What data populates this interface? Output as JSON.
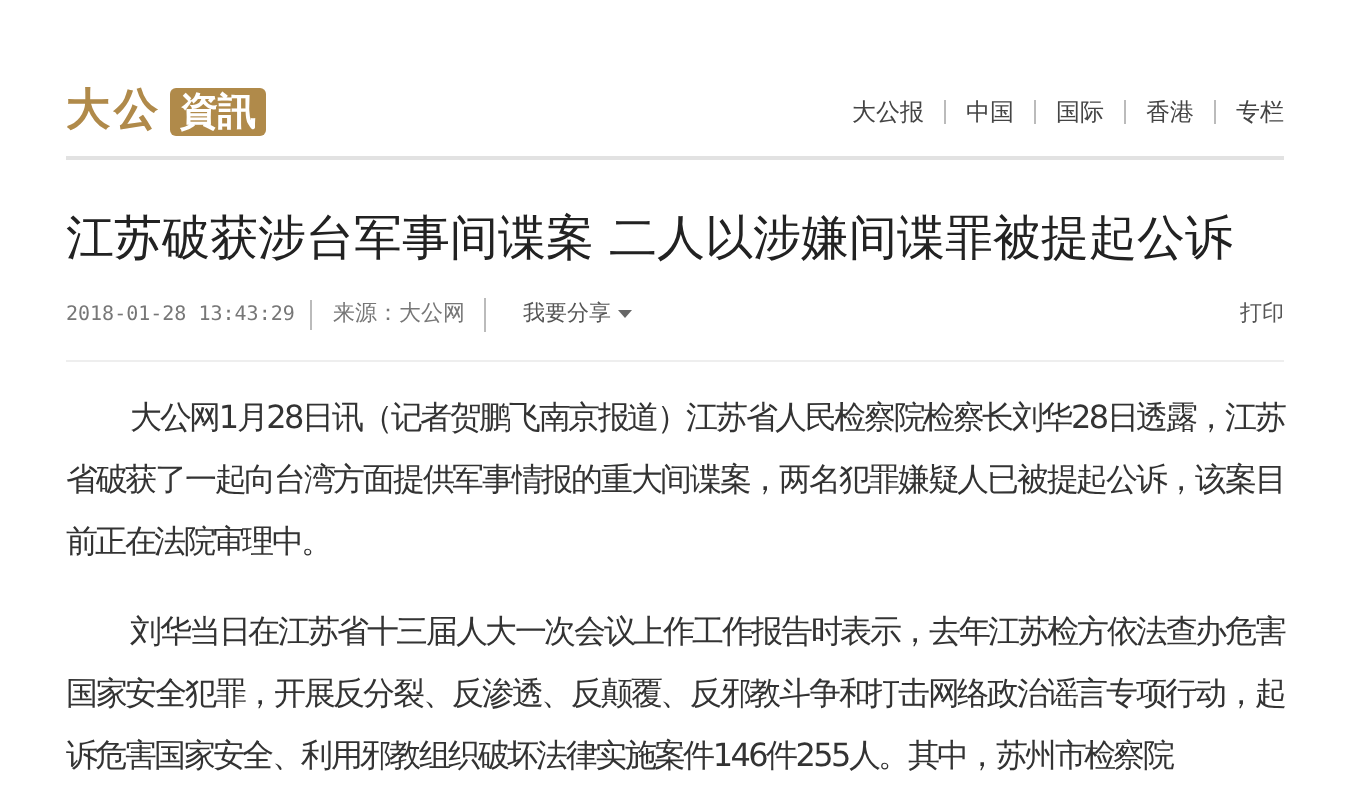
{
  "logo": {
    "brand": "大公",
    "tag": "資訊"
  },
  "nav": [
    {
      "label": "大公报"
    },
    {
      "label": "中国"
    },
    {
      "label": "国际"
    },
    {
      "label": "香港"
    },
    {
      "label": "专栏"
    }
  ],
  "article": {
    "title": "江苏破获涉台军事间谍案 二人以涉嫌间谍罪被提起公诉",
    "meta": {
      "datetime": "2018-01-28 13:43:29",
      "source": "来源：大公网",
      "share": "我要分享",
      "print": "打印"
    },
    "paragraphs": [
      "大公网1月28日讯（记者贺鹏飞南京报道）江苏省人民检察院检察长刘华28日透露，江苏省破获了一起向台湾方面提供军事情报的重大间谍案，两名犯罪嫌疑人已被提起公诉，该案目前正在法院审理中。",
      "刘华当日在江苏省十三届人大一次会议上作工作报告时表示，去年江苏检方依法查办危害国家安全犯罪，开展反分裂、反渗透、反颠覆、反邪教斗争和打击网络政治谣言专项行动，起诉危害国家安全、利用邪教组织破坏法律实施案件146件255人。其中，苏州市检察院"
    ]
  }
}
